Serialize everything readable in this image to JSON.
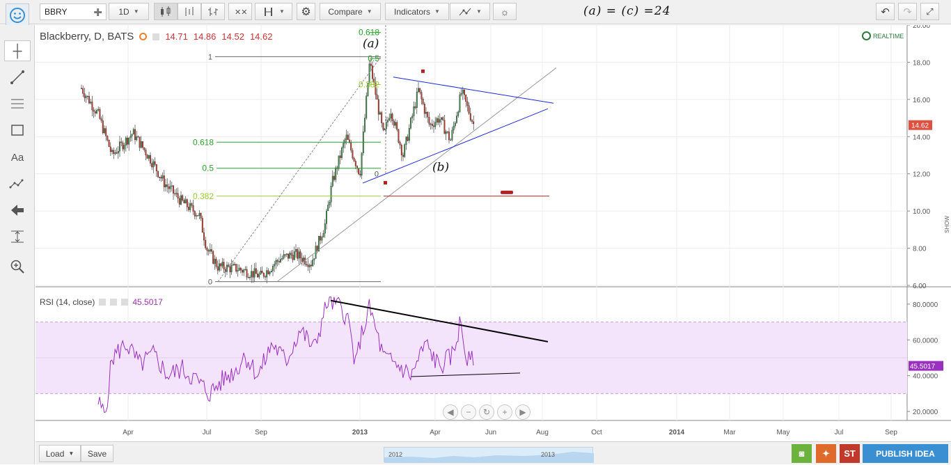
{
  "toolbar": {
    "symbol": "BBRY",
    "interval": "1D",
    "compare_label": "Compare",
    "indicators_label": "Indicators",
    "equation": "(a) = (c) =24"
  },
  "legend": {
    "title": "Blackberry, D, BATS",
    "open": "14.71",
    "high": "14.86",
    "low": "14.52",
    "close": "14.62",
    "realtime": "REALTIME"
  },
  "rsi": {
    "title": "RSI (14, close)",
    "value": "45.5017"
  },
  "bottom": {
    "load_label": "Load",
    "save_label": "Save",
    "st_label": "ST",
    "publish_label": "PUBLISH IDEA",
    "scroller_year_a": "2012",
    "scroller_year_b": "2013"
  },
  "side": {
    "show_label": "SHOW"
  },
  "colors": {
    "up": "#3d8a4a",
    "down": "#c0392b",
    "rsi": "#9b30c0",
    "rsi_band": "#f3e4fb",
    "fib_green": "#2ca02c",
    "fib_yellow": "#9acd32",
    "triangle": "#1a2ad8",
    "last_price": "#e05040"
  },
  "chart_data": {
    "type": "candlestick",
    "y_axis_ticks": [
      "6.00",
      "8.00",
      "10.00",
      "12.00",
      "14.00",
      "16.00",
      "18.00",
      "20.00"
    ],
    "ylim": [
      6,
      20
    ],
    "last_price": "14.62",
    "x_ticks": [
      "Apr",
      "Jul",
      "Sep",
      "2013",
      "Apr",
      "Jun",
      "Aug",
      "Oct",
      "2014",
      "Mar",
      "May",
      "Jul",
      "Sep"
    ],
    "fib_levels_lower": [
      {
        "label": "0.618",
        "value": 13.7
      },
      {
        "label": "0.5",
        "value": 12.3
      },
      {
        "label": "0.382",
        "value": 10.8
      }
    ],
    "fib_levels_upper": [
      {
        "label": "0.618",
        "value": 19.6
      },
      {
        "label": "0.5",
        "value": 18.2
      },
      {
        "label": "0.382",
        "value": 16.8
      }
    ],
    "fib_markers": [
      {
        "label": "1",
        "value": 18.3
      },
      {
        "label": "0",
        "value": 6.2
      },
      {
        "label": "0",
        "value": 12.0
      }
    ],
    "annotations": [
      {
        "label": "(a)",
        "value": 18.8
      },
      {
        "label": "(b)",
        "value": 12.3
      }
    ],
    "rsi_axis_ticks": [
      "20.0000",
      "40.0000",
      "60.0000",
      "80.0000"
    ],
    "rsi_ylim": [
      15,
      85
    ],
    "rsi_band": [
      30,
      70
    ],
    "rsi_last": "45.5017"
  }
}
